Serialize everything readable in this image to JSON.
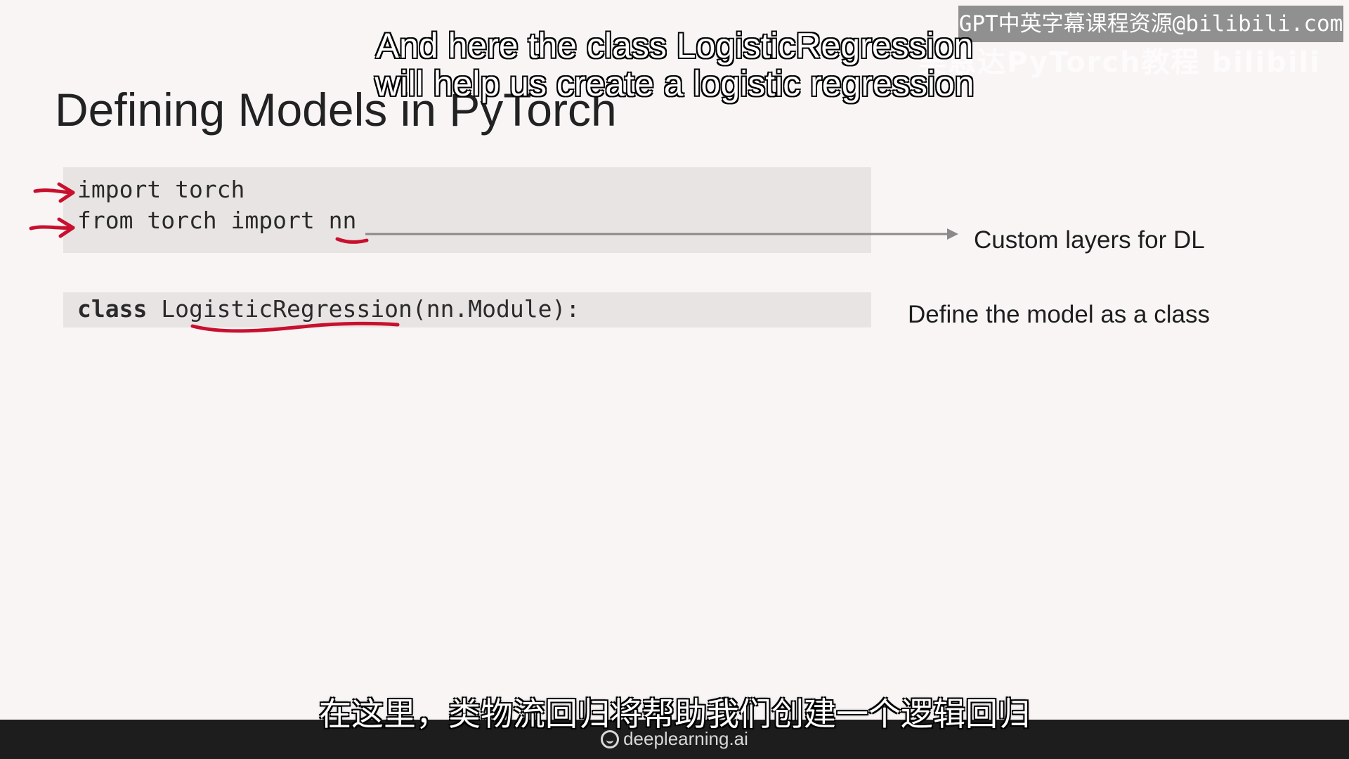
{
  "watermark": {
    "text": "GPT中英字幕课程资源@bilibili.com",
    "ghost_text": "吴恩达PyTorch教程 bilibili"
  },
  "slide": {
    "title": "Defining Models in PyTorch",
    "code_lines": [
      "import torch",
      "from torch import nn"
    ],
    "class_line": {
      "keyword": "class",
      "rest": " LogisticRegression(nn.Module):"
    },
    "annotations": [
      "Custom layers for DL",
      "Define the model as a class"
    ]
  },
  "subtitles": {
    "english_line_1": "And here the class LogisticRegression",
    "english_line_2": "will help us create a logistic regression",
    "chinese": "在这里，类物流回归将帮助我们创建一个逻辑回归"
  },
  "footer": {
    "brand": "deeplearning.ai"
  },
  "colors": {
    "background": "#f9f5f5",
    "code_bg": "#e9e4e4",
    "pen_red": "#c8102e",
    "bottom_bar": "#1d1d1d"
  }
}
